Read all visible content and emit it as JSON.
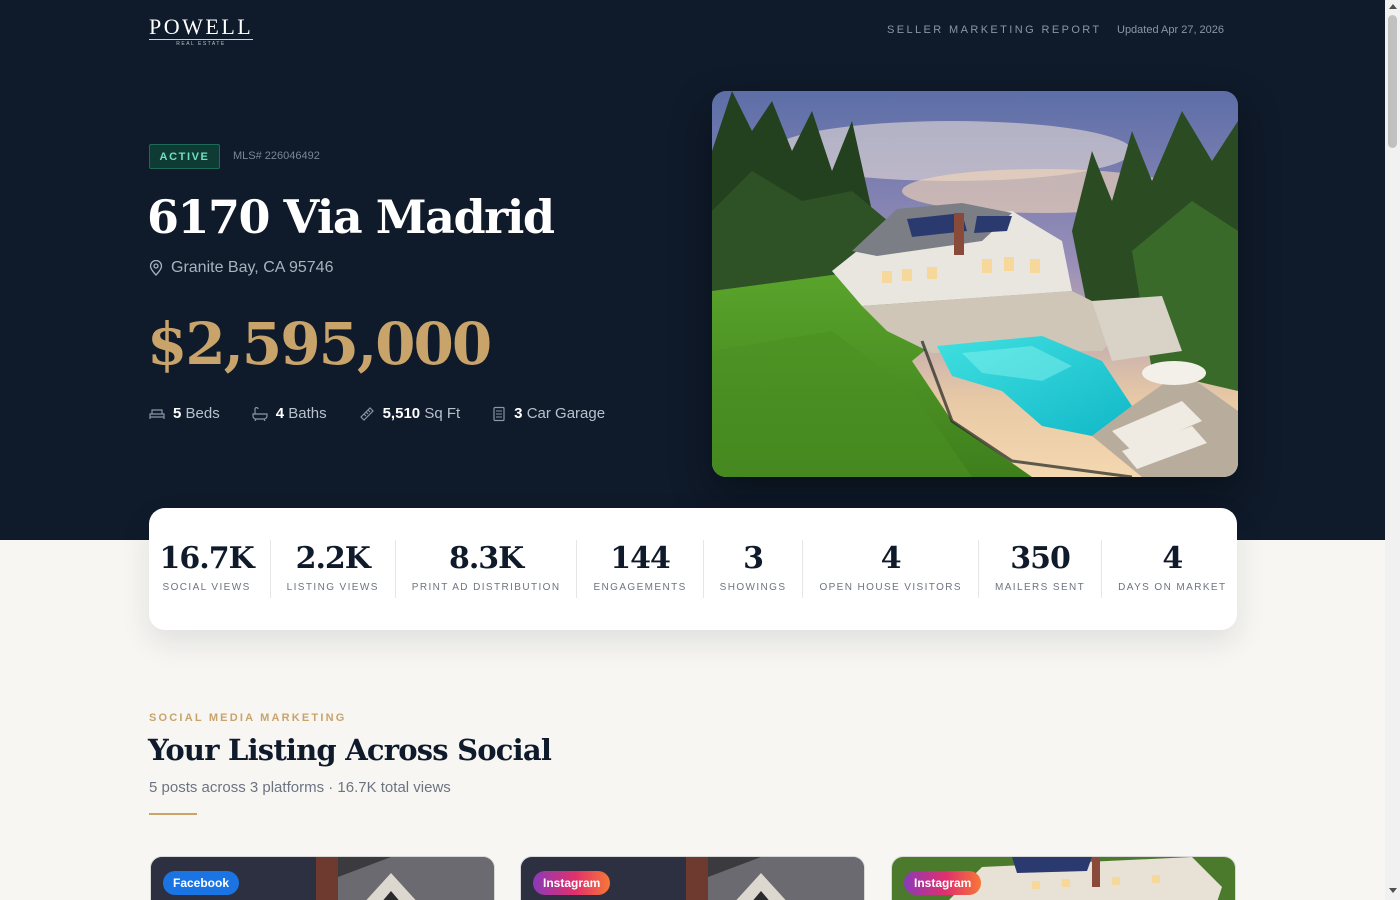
{
  "header": {
    "logo": {
      "name": "POWELL",
      "tagline": "REAL ESTATE"
    },
    "report_title": "SELLER MARKETING REPORT",
    "updated": "Updated Apr 27, 2026"
  },
  "listing": {
    "status": "ACTIVE",
    "mls": "MLS# 226046492",
    "address": "6170 Via Madrid",
    "location": "Granite Bay, CA 95746",
    "location_icon": "map-pin-icon",
    "price": "$2,595,000",
    "features": [
      {
        "icon": "bed-icon",
        "value": "5",
        "label": "Beds"
      },
      {
        "icon": "bath-icon",
        "value": "4",
        "label": "Baths"
      },
      {
        "icon": "ruler-icon",
        "value": "5,510",
        "label": "Sq Ft"
      },
      {
        "icon": "garage-icon",
        "value": "3",
        "label": "Car Garage"
      }
    ],
    "photo": "aerial-home-pool-photo"
  },
  "stats": [
    {
      "value": "16.7K",
      "label": "SOCIAL VIEWS"
    },
    {
      "value": "2.2K",
      "label": "LISTING VIEWS"
    },
    {
      "value": "8.3K",
      "label": "PRINT AD DISTRIBUTION"
    },
    {
      "value": "144",
      "label": "ENGAGEMENTS"
    },
    {
      "value": "3",
      "label": "SHOWINGS"
    },
    {
      "value": "4",
      "label": "OPEN HOUSE VISITORS"
    },
    {
      "value": "350",
      "label": "MAILERS SENT"
    },
    {
      "value": "4",
      "label": "DAYS ON MARKET"
    }
  ],
  "social": {
    "eyebrow": "SOCIAL MEDIA MARKETING",
    "title": "Your Listing Across Social",
    "subtitle": "5 posts across 3 platforms · 16.7K total views",
    "posts": [
      {
        "platform": "Facebook"
      },
      {
        "platform": "Instagram"
      },
      {
        "platform": "Instagram"
      }
    ]
  },
  "colors": {
    "hero_bg": "#0f1a2a",
    "accent_gold": "#c8a46b",
    "status_green": "#6fe0bf",
    "facebook_blue": "#1b74e4"
  }
}
